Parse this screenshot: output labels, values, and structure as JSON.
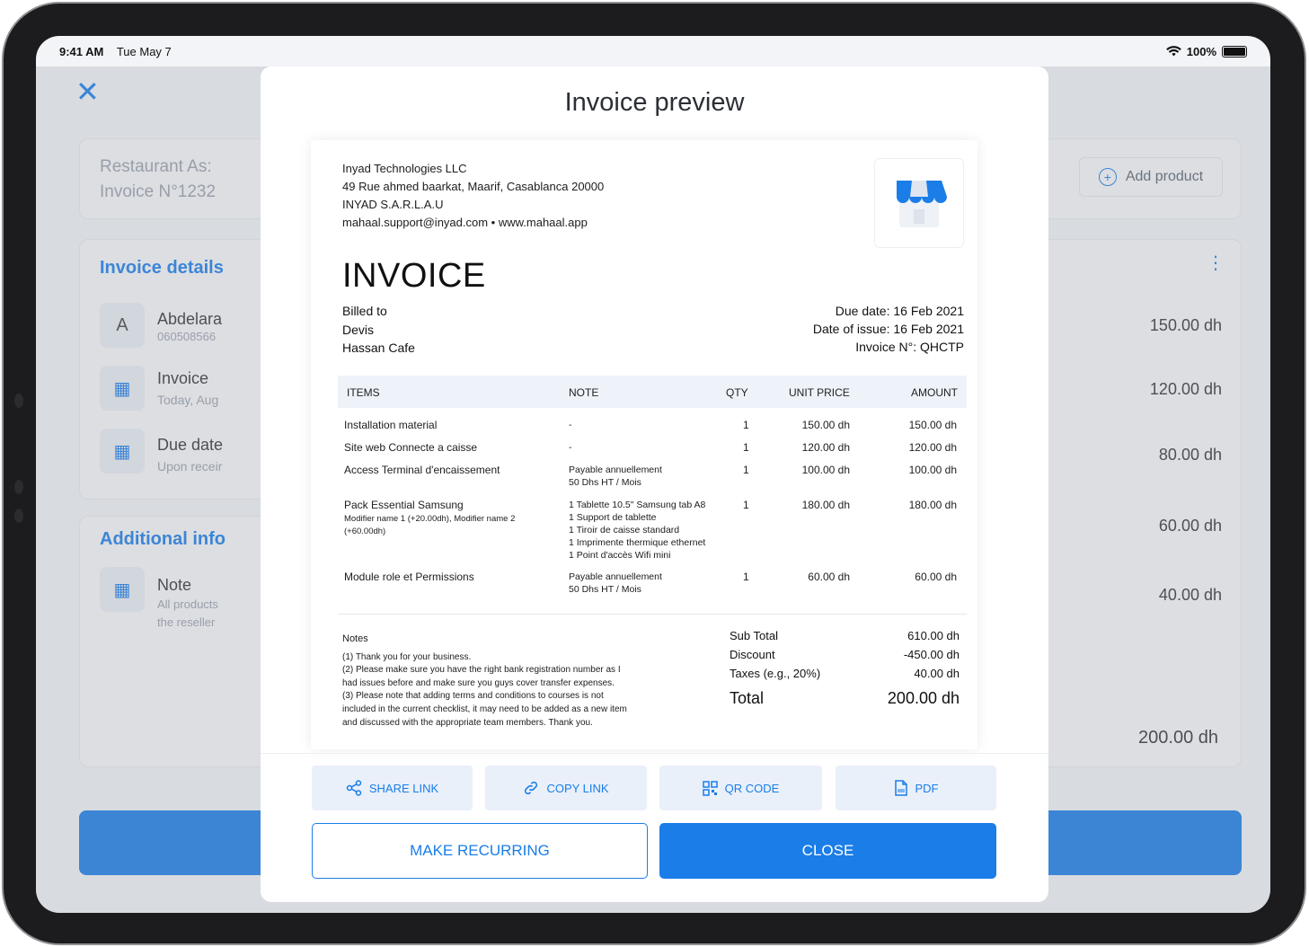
{
  "status": {
    "time": "9:41 AM",
    "date": "Tue May 7",
    "battery": "100%"
  },
  "background": {
    "header": {
      "line1": "Restaurant As:",
      "line2": "Invoice N°1232"
    },
    "add_product": "Add product",
    "invoice_details": {
      "title": "Invoice details",
      "customer_initial": "A",
      "customer_name": "Abdelara",
      "customer_phone": "060508566",
      "invoice_label": "Invoice",
      "invoice_sub": "Today, Aug",
      "due_label": "Due date",
      "due_sub": "Upon receir"
    },
    "additional_info": {
      "title": "Additional info",
      "note_label": "Note",
      "note_line1": "All products",
      "note_line2": "the reseller"
    },
    "prices": [
      "150.00 dh",
      "120.00 dh",
      "80.00 dh",
      "60.00 dh",
      "40.00 dh"
    ],
    "total": "200.00 dh"
  },
  "modal": {
    "title": "Invoice preview",
    "company": {
      "name": "Inyad Technologies LLC",
      "address": "49 Rue ahmed baarkat, Maarif, Casablanca 20000",
      "legal": "INYAD S.A.R.L.A.U",
      "contact": "mahaal.support@inyad.com • www.mahaal.app"
    },
    "heading": "INVOICE",
    "billed": {
      "label": "Billed to",
      "name": "Devis",
      "company": "Hassan Cafe"
    },
    "dates": {
      "due": "Due date: 16 Feb 2021",
      "issue": "Date of issue: 16 Feb 2021",
      "number": "Invoice N°: QHCTP"
    },
    "columns": {
      "items": "ITEMS",
      "note": "NOTE",
      "qty": "QTY",
      "unit": "UNIT PRICE",
      "amount": "AMOUNT"
    },
    "rows": [
      {
        "item": "Installation material",
        "sub": "",
        "note": "-",
        "qty": "1",
        "unit": "150.00 dh",
        "amount": "150.00 dh"
      },
      {
        "item": "Site web Connecte a caisse",
        "sub": "",
        "note": "-",
        "qty": "1",
        "unit": "120.00 dh",
        "amount": "120.00 dh"
      },
      {
        "item": "Access Terminal d'encaissement",
        "sub": "",
        "note": "Payable annuellement\n50 Dhs HT / Mois",
        "qty": "1",
        "unit": "100.00 dh",
        "amount": "100.00 dh"
      },
      {
        "item": "Pack Essential Samsung",
        "sub": "Modifier name 1 (+20.00dh), Modifier name 2\n(+60.00dh)",
        "note": "1 Tablette 10.5\" Samsung tab A8\n1 Support de tablette\n1 Tiroir de caisse standard\n1 Imprimente thermique ethernet\n1 Point d'accès Wifi mini",
        "qty": "1",
        "unit": "180.00 dh",
        "amount": "180.00 dh"
      },
      {
        "item": "Module role et Permissions",
        "sub": "",
        "note": "Payable annuellement\n50 Dhs HT / Mois",
        "qty": "1",
        "unit": "60.00 dh",
        "amount": "60.00 dh"
      }
    ],
    "notes": {
      "title": "Notes",
      "l1": "(1) Thank you for your business.",
      "l2": "(2) Please make sure you have the right bank registration number as I",
      "l3": "had issues before and make sure you guys cover transfer expenses.",
      "l4": "(3) Please note that adding terms and conditions to courses is not",
      "l5": "included in the current checklist, it may need to be added as a new item",
      "l6": "and discussed with the appropriate team members. Thank you."
    },
    "totals": {
      "subtotal_label": "Sub Total",
      "subtotal": "610.00 dh",
      "discount_label": "Discount",
      "discount": "-450.00 dh",
      "taxes_label": "Taxes (e.g., 20%)",
      "taxes": "40.00 dh",
      "total_label": "Total",
      "total": "200.00 dh"
    },
    "actions": {
      "share": "SHARE LINK",
      "copy": "COPY LINK",
      "qr": "QR CODE",
      "pdf": "PDF"
    },
    "make_recurring": "MAKE RECURRING",
    "close": "CLOSE"
  },
  "colors": {
    "accent": "#1a7de8",
    "header_fill": "#eef3fa",
    "button_fill": "#e9f0f9"
  }
}
